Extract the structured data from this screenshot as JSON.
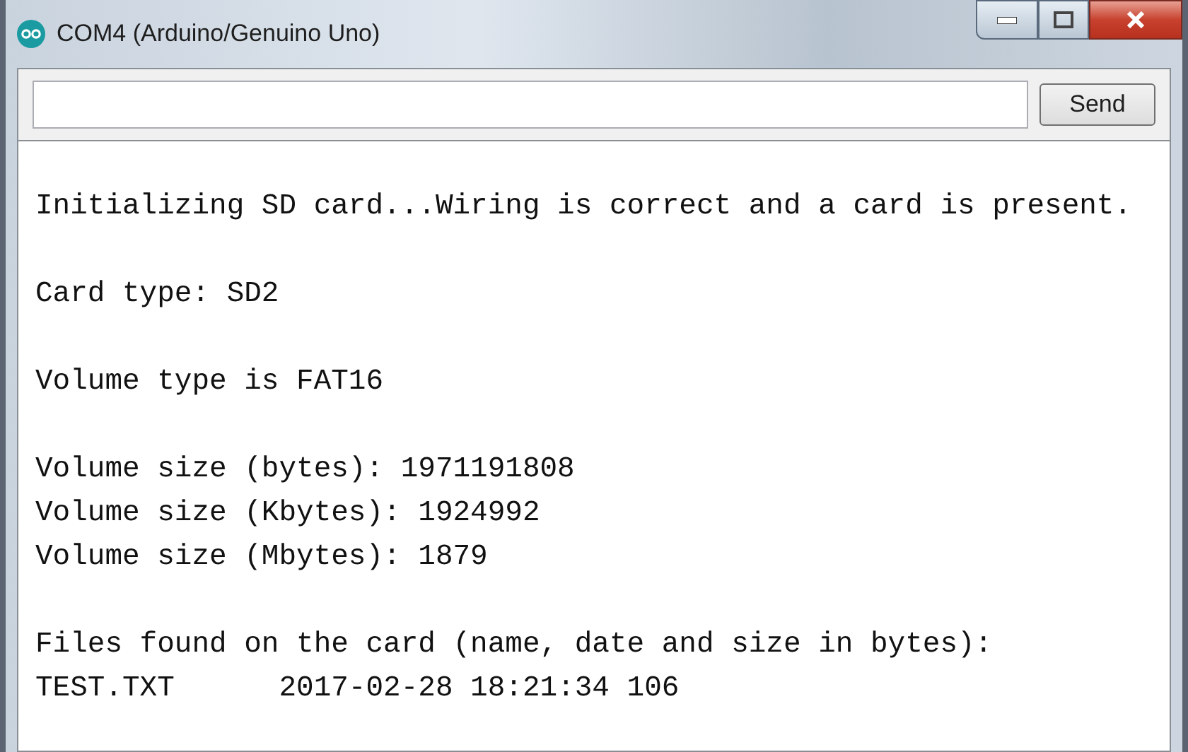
{
  "window": {
    "title": "COM4 (Arduino/Genuino Uno)"
  },
  "send_button": {
    "label": "Send"
  },
  "output": {
    "paragraphs": [
      [
        "Initializing SD card...Wiring is correct and a card is present."
      ],
      [
        "Card type: SD2"
      ],
      [
        "Volume type is FAT16"
      ],
      [
        "Volume size (bytes): 1971191808",
        "Volume size (Kbytes): 1924992",
        "Volume size (Mbytes): 1879"
      ],
      [
        "Files found on the card (name, date and size in bytes):",
        "TEST.TXT      2017-02-28 18:21:34 106"
      ]
    ]
  }
}
